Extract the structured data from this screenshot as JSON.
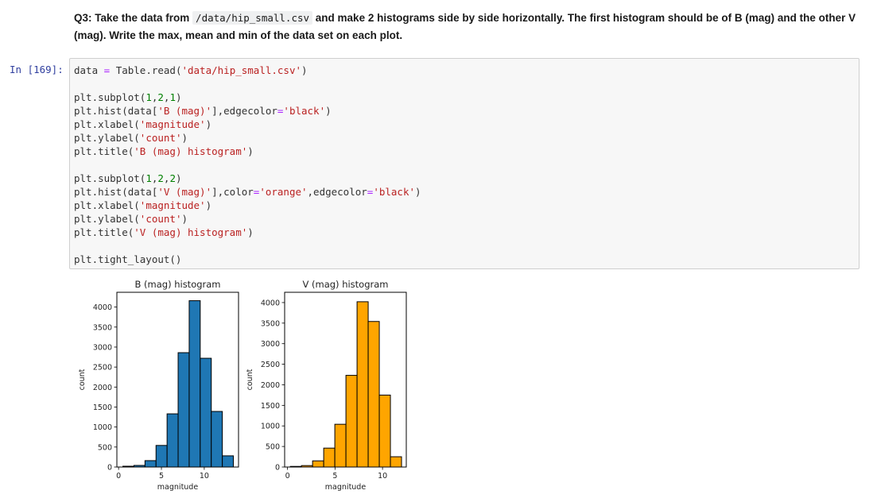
{
  "question": {
    "prefix": "Q3: Take the data from ",
    "code": "/data/hip_small.csv",
    "suffix": " and make 2 histograms side by side horizontally. The first histogram should be of B (mag) and the other V (mag). Write the max, mean and min of the data set on each plot."
  },
  "cell": {
    "prompt": "In [169]:",
    "lines": [
      [
        {
          "t": "data "
        },
        {
          "t": "=",
          "c": "o"
        },
        {
          "t": " Table.read("
        },
        {
          "t": "'data/hip_small.csv'",
          "c": "s"
        },
        {
          "t": ")"
        }
      ],
      [],
      [
        {
          "t": "plt.subplot("
        },
        {
          "t": "1",
          "c": "n"
        },
        {
          "t": ","
        },
        {
          "t": "2",
          "c": "n"
        },
        {
          "t": ","
        },
        {
          "t": "1",
          "c": "n"
        },
        {
          "t": ")"
        }
      ],
      [
        {
          "t": "plt.hist(data["
        },
        {
          "t": "'B (mag)'",
          "c": "s"
        },
        {
          "t": "],edgecolor"
        },
        {
          "t": "=",
          "c": "o"
        },
        {
          "t": "'black'",
          "c": "s"
        },
        {
          "t": ")"
        }
      ],
      [
        {
          "t": "plt.xlabel("
        },
        {
          "t": "'magnitude'",
          "c": "s"
        },
        {
          "t": ")"
        }
      ],
      [
        {
          "t": "plt.ylabel("
        },
        {
          "t": "'count'",
          "c": "s"
        },
        {
          "t": ")"
        }
      ],
      [
        {
          "t": "plt.title("
        },
        {
          "t": "'B (mag) histogram'",
          "c": "s"
        },
        {
          "t": ")"
        }
      ],
      [],
      [
        {
          "t": "plt.subplot("
        },
        {
          "t": "1",
          "c": "n"
        },
        {
          "t": ","
        },
        {
          "t": "2",
          "c": "n"
        },
        {
          "t": ","
        },
        {
          "t": "2",
          "c": "n"
        },
        {
          "t": ")"
        }
      ],
      [
        {
          "t": "plt.hist(data["
        },
        {
          "t": "'V (mag)'",
          "c": "s"
        },
        {
          "t": "],color"
        },
        {
          "t": "=",
          "c": "o"
        },
        {
          "t": "'orange'",
          "c": "s"
        },
        {
          "t": ",edgecolor"
        },
        {
          "t": "=",
          "c": "o"
        },
        {
          "t": "'black'",
          "c": "s"
        },
        {
          "t": ")"
        }
      ],
      [
        {
          "t": "plt.xlabel("
        },
        {
          "t": "'magnitude'",
          "c": "s"
        },
        {
          "t": ")"
        }
      ],
      [
        {
          "t": "plt.ylabel("
        },
        {
          "t": "'count'",
          "c": "s"
        },
        {
          "t": ")"
        }
      ],
      [
        {
          "t": "plt.title("
        },
        {
          "t": "'V (mag) histogram'",
          "c": "s"
        },
        {
          "t": ")"
        }
      ],
      [],
      [
        {
          "t": "plt.tight_layout()"
        }
      ]
    ]
  },
  "chart_data": [
    {
      "type": "bar",
      "title": "B (mag) histogram",
      "xlabel": "magnitude",
      "ylabel": "count",
      "color": "#1f77b4",
      "edgecolor": "#000000",
      "bin_start": 0.5,
      "bin_width": 1.29,
      "values": [
        20,
        40,
        160,
        540,
        1330,
        2860,
        4160,
        2720,
        1390,
        280
      ],
      "xlim": [
        -0.2,
        14.0
      ],
      "ylim": [
        0,
        4370
      ],
      "xticks": [
        0,
        5,
        10
      ],
      "yticks": [
        0,
        500,
        1000,
        1500,
        2000,
        2500,
        3000,
        3500,
        4000
      ],
      "grid": false
    },
    {
      "type": "bar",
      "title": "V (mag) histogram",
      "xlabel": "magnitude",
      "ylabel": "count",
      "color": "#ffa500",
      "edgecolor": "#000000",
      "bin_start": 0.3,
      "bin_width": 1.17,
      "values": [
        15,
        35,
        150,
        460,
        1040,
        2230,
        4020,
        3540,
        1750,
        250
      ],
      "xlim": [
        -0.3,
        12.5
      ],
      "ylim": [
        0,
        4250
      ],
      "xticks": [
        0,
        5,
        10
      ],
      "yticks": [
        0,
        500,
        1000,
        1500,
        2000,
        2500,
        3000,
        3500,
        4000
      ],
      "grid": false
    }
  ]
}
